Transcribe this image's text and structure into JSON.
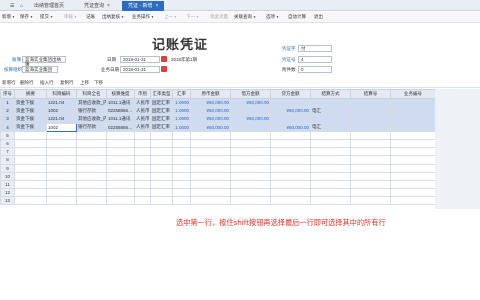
{
  "tabs": [
    {
      "label": "出纳管理首页",
      "active": false
    },
    {
      "label": "凭证查询",
      "active": false
    },
    {
      "label": "凭证 - 新增",
      "active": true
    }
  ],
  "tab_close": "×",
  "toolbar": {
    "items": [
      "新增",
      "保存",
      "提交",
      "审核",
      "记账",
      "出纳复核",
      "业务操作",
      "上一",
      "下一",
      "现金流量",
      "关联查询",
      "选项",
      "自动计算",
      "退出"
    ]
  },
  "form": {
    "title": "记账凭证",
    "account_book_label": "账簿",
    "account_book_value": "蓝海实业集团出纳簿",
    "accounting_org_label": "核算组织",
    "accounting_org_value": "蓝海实业集团",
    "date_label": "日期",
    "date_value": "2018-01-31",
    "period_info": "2018年第1期",
    "business_date_label": "业务日期",
    "business_date_value": "2018-01-31",
    "voucher_word_label": "凭证字",
    "voucher_word_value": "付",
    "voucher_no_label": "凭证号",
    "voucher_no_value": "4",
    "attachments_label": "附件数",
    "attachments_value": "0"
  },
  "subbar": {
    "items": [
      "新增行",
      "删除行",
      "插入行",
      "复制行",
      "上移",
      "下移"
    ]
  },
  "grid": {
    "headers": [
      "序号",
      "摘要",
      "科目编码",
      "科目全名",
      "核算维度",
      "币别",
      "汇率类型",
      "汇率",
      "原币金额",
      "借方金额",
      "贷方金额",
      "结算方式",
      "结算号",
      "业务编号"
    ],
    "rows": [
      [
        "1",
        "资金下拨",
        "1221.04",
        "其他应收款_内",
        "1011.1通讯",
        "人民币",
        "固定汇率",
        "1.0000",
        "¥60,000.00",
        "¥60,000.00",
        "",
        "",
        "",
        ""
      ],
      [
        "2",
        "资金下拨",
        "1002",
        "银行存款",
        "02258856…",
        "人民币",
        "固定汇率",
        "1.0000",
        "¥60,000.00",
        "",
        "¥60,000.00",
        "电汇",
        "",
        ""
      ],
      [
        "3",
        "资金下拨",
        "1221.04",
        "其他应收款_内",
        "1011.1通讯",
        "人民币",
        "固定汇率",
        "1.0000",
        "¥60,000.00",
        "¥60,000.00",
        "",
        "",
        "",
        ""
      ],
      [
        "4",
        "资金下拨",
        "1002",
        "银行存款",
        "02258856…",
        "人民币",
        "固定汇率",
        "1.0000",
        "¥60,000.00",
        "",
        "¥60,000.00",
        "电汇",
        "",
        ""
      ],
      [
        "5",
        "",
        "",
        "",
        "",
        "",
        "",
        "",
        "",
        "",
        "",
        "",
        "",
        ""
      ],
      [
        "6",
        "",
        "",
        "",
        "",
        "",
        "",
        "",
        "",
        "",
        "",
        "",
        "",
        ""
      ],
      [
        "7",
        "",
        "",
        "",
        "",
        "",
        "",
        "",
        "",
        "",
        "",
        "",
        "",
        ""
      ],
      [
        "8",
        "",
        "",
        "",
        "",
        "",
        "",
        "",
        "",
        "",
        "",
        "",
        "",
        ""
      ],
      [
        "9",
        "",
        "",
        "",
        "",
        "",
        "",
        "",
        "",
        "",
        "",
        "",
        "",
        ""
      ],
      [
        "10",
        "",
        "",
        "",
        "",
        "",
        "",
        "",
        "",
        "",
        "",
        "",
        "",
        ""
      ],
      [
        "11",
        "",
        "",
        "",
        "",
        "",
        "",
        "",
        "",
        "",
        "",
        "",
        "",
        ""
      ],
      [
        "12",
        "",
        "",
        "",
        "",
        "",
        "",
        "",
        "",
        "",
        "",
        "",
        "",
        ""
      ],
      [
        "13",
        "",
        "",
        "",
        "",
        "",
        "",
        "",
        "",
        "",
        "",
        "",
        "",
        ""
      ]
    ]
  },
  "annotation": "选中第一行，按住shift按钮再选择最后一行即可选择其中的所有行",
  "colors": {
    "accent": "#2d6cc0",
    "selected_row": "#cfdbf1",
    "annotation": "#e0342b"
  }
}
